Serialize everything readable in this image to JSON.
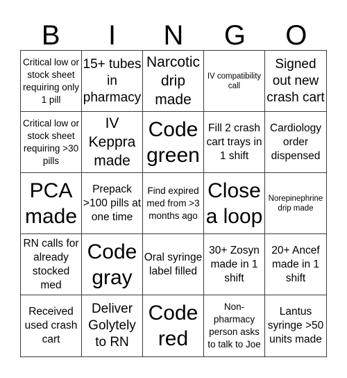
{
  "title_letters": [
    "B",
    "I",
    "N",
    "G",
    "O"
  ],
  "cells": [
    {
      "text": "Critical low or stock sheet requiring only 1 pill",
      "size": "s-sm"
    },
    {
      "text": "15+ tubes in pharmacy",
      "size": "s-lg"
    },
    {
      "text": "Narcotic drip made",
      "size": "s-xl"
    },
    {
      "text": "IV compatibility call",
      "size": "s-xs"
    },
    {
      "text": "Signed out new crash cart",
      "size": "s-lg"
    },
    {
      "text": "Critical low or stock sheet requiring >30 pills",
      "size": "s-sm"
    },
    {
      "text": "IV Keppra made",
      "size": "s-xl"
    },
    {
      "text": "Code green",
      "size": "s-xxl"
    },
    {
      "text": "Fill 2 crash cart trays in 1 shift",
      "size": "s-md"
    },
    {
      "text": "Cardiology order dispensed",
      "size": "s-md"
    },
    {
      "text": "PCA made",
      "size": "s-xxl"
    },
    {
      "text": "Prepack >100 pills at one time",
      "size": "s-md"
    },
    {
      "text": "Find expired med from >3 months ago",
      "size": "s-sm"
    },
    {
      "text": "Close a loop",
      "size": "s-xxl"
    },
    {
      "text": "Norepinephrine drip made",
      "size": "s-xs"
    },
    {
      "text": "RN calls for already stocked med",
      "size": "s-md"
    },
    {
      "text": "Code gray",
      "size": "s-xxl"
    },
    {
      "text": "Oral syringe label filled",
      "size": "s-md"
    },
    {
      "text": "30+ Zosyn made in 1 shift",
      "size": "s-md"
    },
    {
      "text": "20+ Ancef made in 1 shift",
      "size": "s-md"
    },
    {
      "text": "Received used crash cart",
      "size": "s-md"
    },
    {
      "text": "Deliver Golytely to RN",
      "size": "s-lg"
    },
    {
      "text": "Code red",
      "size": "s-xxl"
    },
    {
      "text": "Non-pharmacy person asks to talk to Joe",
      "size": "s-sm"
    },
    {
      "text": "Lantus syringe >50 units made",
      "size": "s-md"
    }
  ]
}
